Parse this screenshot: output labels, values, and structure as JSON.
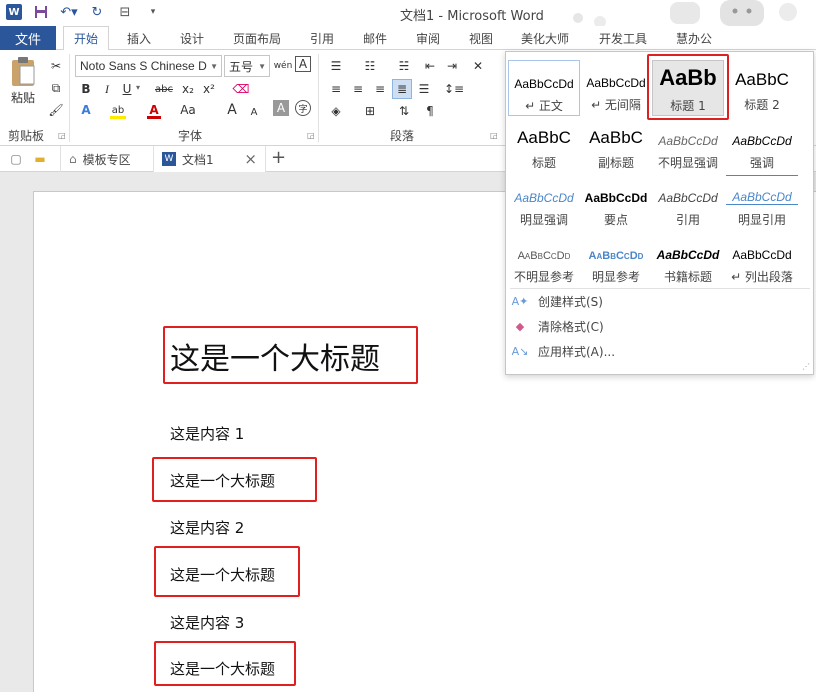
{
  "window": {
    "title": "文档1 - Microsoft Word",
    "app_icon": "W"
  },
  "tabs": {
    "file": "文件",
    "items": [
      "开始",
      "插入",
      "设计",
      "页面布局",
      "引用",
      "邮件",
      "审阅",
      "视图",
      "美化大师",
      "开发工具",
      "慧办公"
    ],
    "active_index": 0
  },
  "ribbon": {
    "clipboard": {
      "paste_label": "粘贴",
      "group_label": "剪贴板"
    },
    "font": {
      "font_name": "Noto Sans S Chinese D",
      "font_size": "五号",
      "group_label": "字体",
      "bold": "B",
      "italic": "I",
      "underline": "U",
      "strike": "abc",
      "sub": "x₂",
      "sup": "x²",
      "grow": "A",
      "shrink": "A",
      "case": "Aa",
      "clear_char": "A",
      "phonetic": "wén",
      "border_char": "A"
    },
    "paragraph": {
      "group_label": "段落"
    }
  },
  "doc_tabs": {
    "template_zone": "模板专区",
    "doc_name": "文档1",
    "close": "×",
    "add": "+"
  },
  "document": {
    "heading": "这是一个大标题",
    "blocks": [
      {
        "content": "这是内容 1",
        "heading": "这是一个大标题"
      },
      {
        "content": "这是内容 2",
        "heading": "这是一个大标题"
      },
      {
        "content": "这是内容 3",
        "heading": "这是一个大标题"
      }
    ]
  },
  "styles": {
    "items": [
      {
        "preview": "AaBbCcDd",
        "name": "↵ 正文"
      },
      {
        "preview": "AaBbCcDd",
        "name": "↵ 无间隔"
      },
      {
        "preview": "AaBb",
        "name": "标题 1"
      },
      {
        "preview": "AaBbC",
        "name": "标题 2"
      },
      {
        "preview": "AaBbC",
        "name": "标题"
      },
      {
        "preview": "AaBbC",
        "name": "副标题"
      },
      {
        "preview": "AaBbCcDd",
        "name": "不明显强调"
      },
      {
        "preview": "AaBbCcDd",
        "name": "强调"
      },
      {
        "preview": "AaBbCcDd",
        "name": "明显强调"
      },
      {
        "preview": "AaBbCcDd",
        "name": "要点"
      },
      {
        "preview": "AaBbCcDd",
        "name": "引用"
      },
      {
        "preview": "AaBbCcDd",
        "name": "明显引用"
      },
      {
        "preview": "AaBbCcDd",
        "name": "不明显参考"
      },
      {
        "preview": "AaBbCcDd",
        "name": "明显参考"
      },
      {
        "preview": "AaBbCcDd",
        "name": "书籍标题"
      },
      {
        "preview": "AaBbCcDd",
        "name": "↵ 列出段落"
      }
    ],
    "menu": {
      "create": "创建样式(S)",
      "clear": "清除格式(C)",
      "apply": "应用样式(A)..."
    }
  },
  "colors": {
    "word_blue": "#2b579a",
    "highlight_red": "#e02020"
  }
}
